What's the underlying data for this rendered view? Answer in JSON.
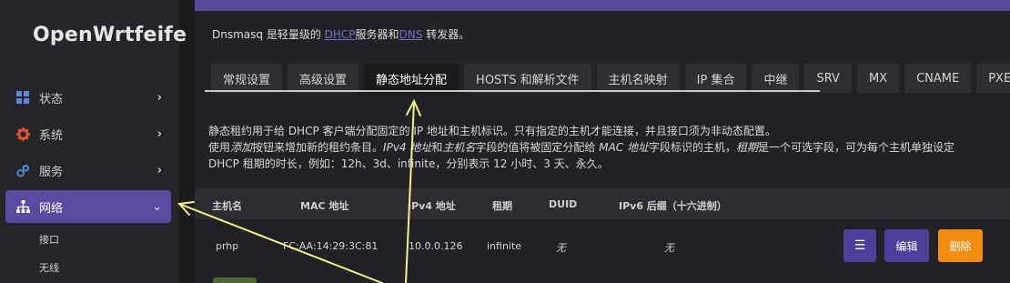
{
  "sidebar": {
    "logo": "OpenWrtfeife",
    "items": [
      {
        "label": "状态",
        "icon": "dashboard-icon",
        "icon_color": "#5a8ad4"
      },
      {
        "label": "系统",
        "icon": "gear-icon",
        "icon_color": "#e4572e"
      },
      {
        "label": "服务",
        "icon": "services-icon",
        "icon_color": "#4a90d9"
      },
      {
        "label": "网络",
        "icon": "network-icon",
        "icon_color": "#ffffff",
        "active": true
      }
    ],
    "subitems": [
      "接口",
      "无线"
    ]
  },
  "main": {
    "intro_prefix": "Dnsmasq 是轻量级的 ",
    "intro_dhcp": "DHCP",
    "intro_mid": "服务器和",
    "intro_dns": "DNS",
    "intro_suffix": " 转发器。",
    "tabs": [
      "常规设置",
      "高级设置",
      "静态地址分配",
      "HOSTS 和解析文件",
      "主机名映射",
      "IP 集合",
      "中继",
      "SRV",
      "MX",
      "CNAME",
      "PXE/"
    ],
    "active_tab": 2,
    "desc_line1": "静态租约用于给 DHCP 客户端分配固定的 IP 地址和主机标识。只有指定的主机才能连接，并且接口须为非动态配置。",
    "desc_line2_a": "使用",
    "desc_line2_b": "添加",
    "desc_line2_c": "按钮来增加新的租约条目。",
    "desc_line2_d": "IPv4 地址",
    "desc_line2_e": "和",
    "desc_line2_f": "主机名",
    "desc_line2_g": "字段的值将被固定分配给 ",
    "desc_line2_h": "MAC 地址",
    "desc_line2_i": "字段标识的主机，",
    "desc_line2_j": "租期",
    "desc_line2_k": "是一个可选字段，可为每个主机单独设定",
    "desc_line3": "DHCP 租期的时长，例如：12h、3d、infinite，分别表示 12 小时、3 天、永久。",
    "table": {
      "headers": [
        "主机名",
        "MAC 地址",
        "IPv4 地址",
        "租期",
        "DUID",
        "IPv6 后缀（十六进制）"
      ],
      "rows": [
        {
          "hostname": "prhp",
          "mac": "FC:AA:14:29:3C:81",
          "ipv4": "10.0.0.126",
          "lease": "infinite",
          "duid": "无",
          "ipv6": "无"
        }
      ]
    },
    "buttons": {
      "menu": "☰",
      "edit": "编辑",
      "delete": "删除"
    }
  },
  "colors": {
    "accent": "#5b4aa0",
    "delete": "#f28c0e",
    "annotation_arrow": "#f5f08a"
  }
}
